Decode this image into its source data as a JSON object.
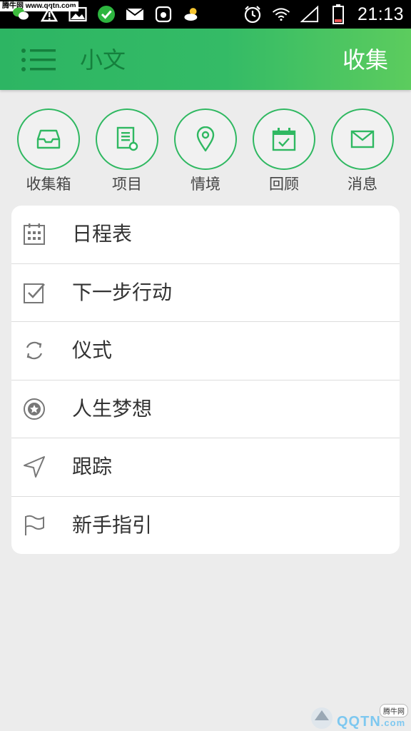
{
  "status_bar": {
    "watermark": "腾牛网 www.qqtn.com",
    "time": "21:13",
    "icons_left": [
      "wechat-icon",
      "warning-icon",
      "image-icon",
      "check-circle-icon",
      "mail-icon",
      "app-icon",
      "weather-icon"
    ],
    "icons_right": [
      "alarm-icon",
      "wifi-icon",
      "signal-icon",
      "battery-icon"
    ]
  },
  "app_bar": {
    "title": "小文",
    "action": "收集",
    "accent": "#2db563"
  },
  "quick_actions": [
    {
      "label": "收集箱",
      "icon": "inbox-icon"
    },
    {
      "label": "项目",
      "icon": "project-icon"
    },
    {
      "label": "情境",
      "icon": "location-pin-icon"
    },
    {
      "label": "回顾",
      "icon": "calendar-check-icon"
    },
    {
      "label": "消息",
      "icon": "envelope-icon"
    }
  ],
  "menu": [
    {
      "label": "日程表",
      "icon": "calendar-grid-icon"
    },
    {
      "label": "下一步行动",
      "icon": "checkbox-icon"
    },
    {
      "label": "仪式",
      "icon": "refresh-icon"
    },
    {
      "label": "人生梦想",
      "icon": "star-badge-icon"
    },
    {
      "label": "跟踪",
      "icon": "navigation-arrow-icon"
    },
    {
      "label": "新手指引",
      "icon": "flag-icon"
    }
  ],
  "bottom_watermark": {
    "brand": "QQTN",
    "suffix": ".com",
    "badge": "腾牛网"
  }
}
